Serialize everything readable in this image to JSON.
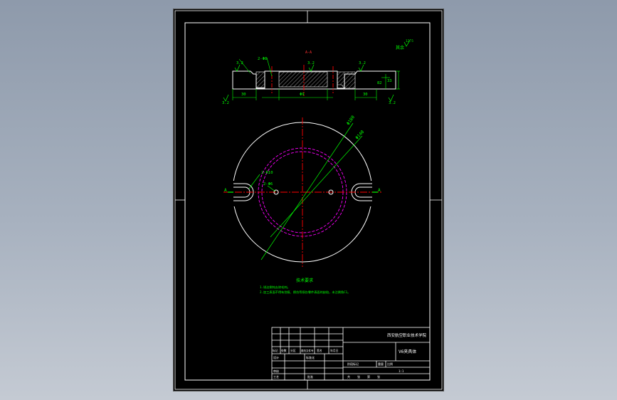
{
  "colors": {
    "canvas": "#000000",
    "frame": "#ffffff",
    "dimension": "#00ff00",
    "centerline": "#ff0000",
    "hidden": "#ff00ff",
    "hatch": "#ffffff",
    "title_text": "#ffffff"
  },
  "section_view": {
    "label": "A-A",
    "surface_finish_note": "其余",
    "roughness_values": [
      "3.2",
      "3.2",
      "3.2",
      "3.2",
      "3.2",
      "12.5"
    ],
    "dimensions": {
      "hole_note": "2-Φ8",
      "left_width": "30",
      "center_width": "Φ9",
      "right_width": "30",
      "height_a": "82",
      "height_b": "33"
    }
  },
  "plan_view": {
    "slot_note": "2-R10",
    "hole_note": "2-Φ6",
    "dia_outer": "Φ180",
    "dia_inner": "Φ140",
    "section_mark_left": "A",
    "section_mark_right": "A"
  },
  "notes": {
    "heading": "技术要求",
    "lines": [
      "1.锐边倒钝去除毛刺。",
      "2.加工表面不得有划痕、擦伤等损伤零件表面的缺陷，未注倒角C1。"
    ]
  },
  "title_block": {
    "institution": "西安航空职业技术学院",
    "part_name": "V6夹具体",
    "rev_headers": [
      "标记",
      "处数",
      "分区",
      "更改文件号",
      "签名",
      "年月日"
    ],
    "roles": [
      "设计",
      "审核",
      "工艺"
    ],
    "std_label": "标准化",
    "approve_label": "批准",
    "stage_headers": [
      "阶段标记",
      "重量",
      "比例"
    ],
    "scale": "1:1",
    "sheet_info": [
      "共",
      "张",
      "第",
      "张"
    ]
  }
}
